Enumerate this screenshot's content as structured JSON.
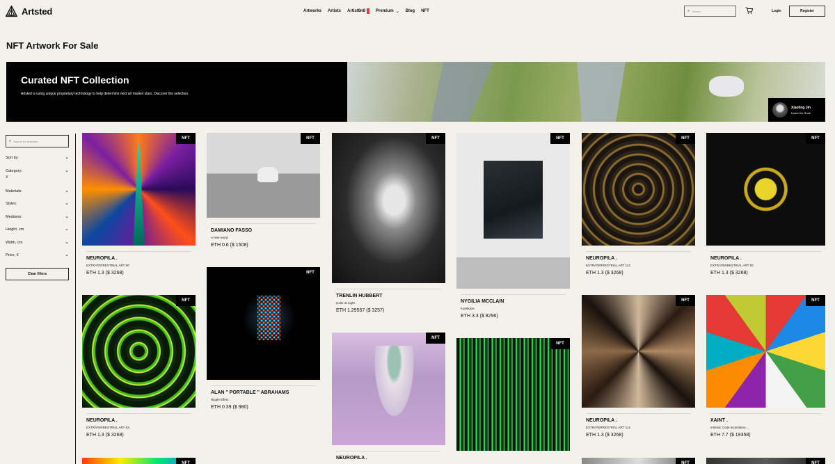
{
  "header": {
    "logo": "Artsted",
    "nav": [
      {
        "label": "Artworks"
      },
      {
        "label": "Artists"
      },
      {
        "label": "Artist8n8"
      },
      {
        "label": "Premium"
      },
      {
        "label": "Blog"
      },
      {
        "label": "NFT"
      }
    ],
    "search_placeholder": "Search",
    "login": "Login",
    "register": "Register"
  },
  "page_title": "NFT Artwork For Sale",
  "banner": {
    "title": "Curated NFT Collection",
    "description": "Artsted is using unique proprietary technology to help determine next art market stars. Discover the selection.",
    "credit_name": "Xiaoling Jin",
    "credit_work": "Under the Shell"
  },
  "sidebar": {
    "search_placeholder": "Search for Artworks...",
    "filters": [
      {
        "label": "Sort by:"
      },
      {
        "label": "Category:",
        "value": "X"
      },
      {
        "label": "Materials:"
      },
      {
        "label": "Styles:"
      },
      {
        "label": "Mediums:"
      },
      {
        "label": "Height, cm"
      },
      {
        "label": "Width, cm"
      },
      {
        "label": "Price, €"
      }
    ],
    "clear_label": "Clear filters"
  },
  "nft_tag": "NFT",
  "cards": [
    {
      "artist": "NEUROPILA .",
      "title": "EXTRATERRESTRIAL ART 60.",
      "price": "ETH 1.3 ($ 3268)",
      "pattern": "p-neon"
    },
    {
      "artist": "DAMIANO FASSO",
      "title": "A new world.",
      "price": "ETH 0.6 ($ 1508)",
      "pattern": "p-road"
    },
    {
      "artist": "TRENLIN HUBBERT",
      "title": "Color at Light.",
      "price": "ETH 1.29557 ($ 3257)",
      "pattern": "p-hermit"
    },
    {
      "artist": "NYGILIA MCCLAIN",
      "title": "Kamikaze.",
      "price": "ETH 3.3 ($ 8296)",
      "pattern": "p-canvas"
    },
    {
      "artist": "NEUROPILA .",
      "title": "EXTRATERRESTRIAL ART 113.",
      "price": "ETH 1.3 ($ 3268)",
      "pattern": "p-gold"
    },
    {
      "artist": "NEUROPILA .",
      "title": "EXTRATERRESTRIAL ART 50.",
      "price": "ETH 1.3 ($ 3268)",
      "pattern": "p-yellow"
    },
    {
      "artist": "NEUROPILA .",
      "title": "EXTRATERRESTRIAL ART 63.",
      "price": "ETH 1.3 ($ 3268)",
      "pattern": "p-green"
    },
    {
      "artist": "ALAN \" PORTABLE \" ABRAHAMS",
      "title": "Ripple Effect .",
      "price": "ETH 0.39 ($ 980)",
      "pattern": "p-black"
    },
    {
      "artist": "NEUROPILA .",
      "title": "",
      "price": "",
      "pattern": "p-pink"
    },
    {
      "artist": "",
      "title": "",
      "price": "",
      "pattern": "p-greenstripe"
    },
    {
      "artist": "NEUROPILA .",
      "title": "EXTRATERRESTRIAL ART 114.",
      "price": "ETH 1.3 ($ 3268)",
      "pattern": "p-cross"
    },
    {
      "artist": "XAINT .",
      "title": "Intrinsic Code incantation...",
      "price": "ETH 7.7 ($ 19358)",
      "pattern": "p-fractal"
    }
  ]
}
